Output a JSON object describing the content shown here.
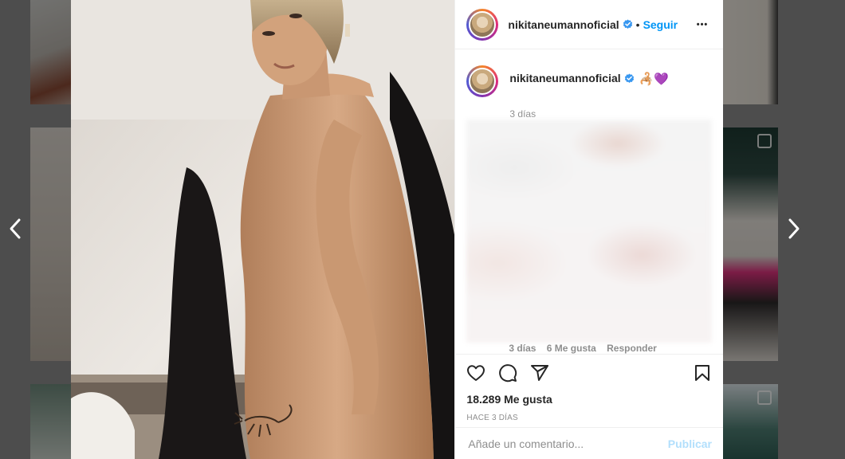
{
  "post": {
    "username": "nikitaneumannoficial",
    "follow_label": "Seguir",
    "separator": "•",
    "more_label": "•••"
  },
  "caption": {
    "username": "nikitaneumannoficial",
    "emojis": "🦂💜",
    "time": "3 días"
  },
  "comment_trail": {
    "time": "3 días",
    "likes": "6 Me gusta",
    "reply": "Responder"
  },
  "actions": {
    "likes_count": "18.289 Me gusta",
    "posted_ago": "HACE 3 DÍAS"
  },
  "comment_form": {
    "placeholder": "Añade un comentario...",
    "publish_label": "Publicar"
  },
  "icons": {
    "prev": "chevron-left-icon",
    "next": "chevron-right-icon",
    "like": "heart-icon",
    "comment": "comment-icon",
    "share": "paper-plane-icon",
    "save": "bookmark-icon",
    "verified": "verified-badge-icon"
  },
  "colors": {
    "accent": "#0095f6",
    "publish_disabled": "#b2dffc",
    "muted_text": "#8e8e8e",
    "primary_text": "#262626"
  }
}
